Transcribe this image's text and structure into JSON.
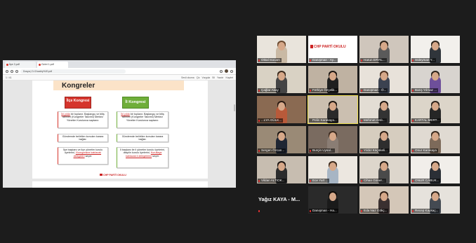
{
  "browser": {
    "tabs": [
      {
        "label": "İlçe 2.pdf",
        "active": false
      },
      {
        "label": "Gzbri 1.pdf",
        "active": true
      }
    ],
    "url": "Dosya | D:/2.kadriy%20.pdf",
    "pdf_toolbar": [
      "Sesli okuma",
      "Çiz",
      "Vurgula",
      "Sil",
      "Yazdır",
      "Kaydet"
    ],
    "page_indicator": "1 / 41"
  },
  "slide": {
    "title": "Kongreler",
    "ilce_box": "İlçe Kongresi",
    "il_box": "İl Kongresi",
    "left_cards": [
      {
        "pre": "",
        "link": "İki yılda",
        "post": " bir toplanır. Başlangıç ve bitiş tarihleri (Kongreler Takvimi) Merkez Yönetim Kurulunca saptanır."
      },
      {
        "pre": "Gündemde belirtilen konuları karara bağlar.",
        "link": "",
        "post": ""
      },
      {
        "pre": "İlçe başkanı ve ilçe yönetim kurulu üyelerini, ",
        "link": "il kongresine katılacak delegeleri",
        "post": " seçer."
      }
    ],
    "right_cards": [
      {
        "pre": "",
        "link": "İki yılda",
        "post": " bir toplanır. Başlangıç ve bitiş tarihleri (Kongreler Takvimi) Merkez Yönetim Kurulunca saptanır."
      },
      {
        "pre": "Gündemde belirtilen konuları karara bağlar.",
        "link": "",
        "post": ""
      },
      {
        "pre": "İl başkanı ile il yönetim kurulu üyelerini, disiplin kurulu üyelerini, ",
        "link": "Kurultaya katılacak il delegelerini",
        "post": " seçer."
      }
    ],
    "footer_logo": "CHP PARTİ OKULU"
  },
  "gallery": {
    "tiles": [
      {
        "name": "Oktal Isocam",
        "kind": "video",
        "bg": "#e9e4dc",
        "shirt": "#c9b9a4",
        "hair": "#6b4a30",
        "muted": true
      },
      {
        "name": "Danışman - Ay...",
        "kind": "logo",
        "logo_text": "CHP PARTİ OKULU",
        "bg": "#ffffff",
        "muted": true
      },
      {
        "name": "Harun ERYIL...",
        "kind": "video",
        "bg": "#cfc6bc",
        "shirt": "#5a5a5a",
        "hair": "#2b2219",
        "muted": true
      },
      {
        "name": "Süleyman Y...",
        "kind": "video",
        "bg": "#f2f0ec",
        "shirt": "#30353b",
        "hair": "#2b2219",
        "muted": true
      },
      {
        "name": "Çağlar Akay",
        "kind": "video",
        "bg": "#d9d2c4",
        "shirt": "#444444",
        "hair": "#3a2a1d",
        "muted": true
      },
      {
        "name": "Fethiye Özçelik...",
        "kind": "video",
        "bg": "#bfb2a2",
        "shirt": "#1f1f1f",
        "hair": "#1a1410",
        "muted": true
      },
      {
        "name": "Danışman - Ö...",
        "kind": "video",
        "bg": "#e8e2da",
        "shirt": "#3b4250",
        "hair": "#4a3020",
        "muted": true
      },
      {
        "name": "Barış Yılmaz ...",
        "kind": "video",
        "bg": "#d8d4cf",
        "shirt": "#6e4f9a",
        "hair": "#2a2018",
        "muted": true
      },
      {
        "name": "...LYA GÜLK...",
        "kind": "video",
        "bg": "#8a6a52",
        "shirt": "#b85a3a",
        "hair": "#2a1a12",
        "muted": true
      },
      {
        "name": "Pelin Karakaya...",
        "kind": "video",
        "bg": "#cbbfb0",
        "shirt": "#2a2a2a",
        "hair": "#1e1610",
        "muted": false,
        "active": true
      },
      {
        "name": "Mehmet Arslı...",
        "kind": "video",
        "bg": "#e3ddd4",
        "shirt": "#333333",
        "hair": "#1c1510",
        "muted": true
      },
      {
        "name": "KARTAL MERT...",
        "kind": "video",
        "bg": "#dcd5c9",
        "shirt": "#262626",
        "hair": "#2c2119",
        "muted": true
      },
      {
        "name": "Sergen Özcan...",
        "kind": "video",
        "bg": "#9a8a76",
        "shirt": "#1f2633",
        "hair": "#1a1410",
        "muted": true
      },
      {
        "name": "Burçin Uysal...",
        "kind": "video",
        "bg": "#7a6b60",
        "shirt": "#8a7d74",
        "hair": "#3d2c20",
        "muted": true
      },
      {
        "name": "Yıldız Küçükeli...",
        "kind": "video",
        "bg": "#d6cdbf",
        "shirt": "#2e2e2e",
        "hair": "#2a1d14",
        "muted": true
      },
      {
        "name": "Onur Karakaya",
        "kind": "video",
        "bg": "#e0dad2",
        "shirt": "#7d6a5a",
        "hair": "#3a2a1e",
        "muted": true
      },
      {
        "name": "Vildan ALTIOK...",
        "kind": "video",
        "bg": "#c7bdb0",
        "shirt": "#2b2b2b",
        "hair": "#1b1410",
        "muted": true
      },
      {
        "name": "Ece Yurt ...",
        "kind": "video",
        "bg": "#ece7e0",
        "shirt": "#a7b5c4",
        "hair": "#3c2a1c",
        "muted": true
      },
      {
        "name": "Cihan Güner...",
        "kind": "video",
        "bg": "#ddd6cc",
        "shirt": "#4a4a4a",
        "hair": "#1e1813",
        "muted": true
      },
      {
        "name": "ONUR CABUK...",
        "kind": "video",
        "bg": "#f1eeea",
        "shirt": "#2b2f36",
        "hair": "#1c1612",
        "muted": true
      },
      {
        "name": "Yağız KAYA - M...",
        "kind": "text",
        "muted": true
      },
      {
        "name": "Danışman - Ha...",
        "kind": "video",
        "bg": "#2a2a2a",
        "shirt": "#1a1a1a",
        "hair": "#100c09",
        "muted": true
      },
      {
        "name": "Eda Naz Gökç...",
        "kind": "video",
        "bg": "#d4c7b8",
        "shirt": "#3a3030",
        "hair": "#2c1d14",
        "muted": true
      },
      {
        "name": "Recep Kaykaç...",
        "kind": "video",
        "bg": "#e6e2dc",
        "shirt": "#444a52",
        "hair": "#2a2019",
        "muted": true
      }
    ]
  }
}
